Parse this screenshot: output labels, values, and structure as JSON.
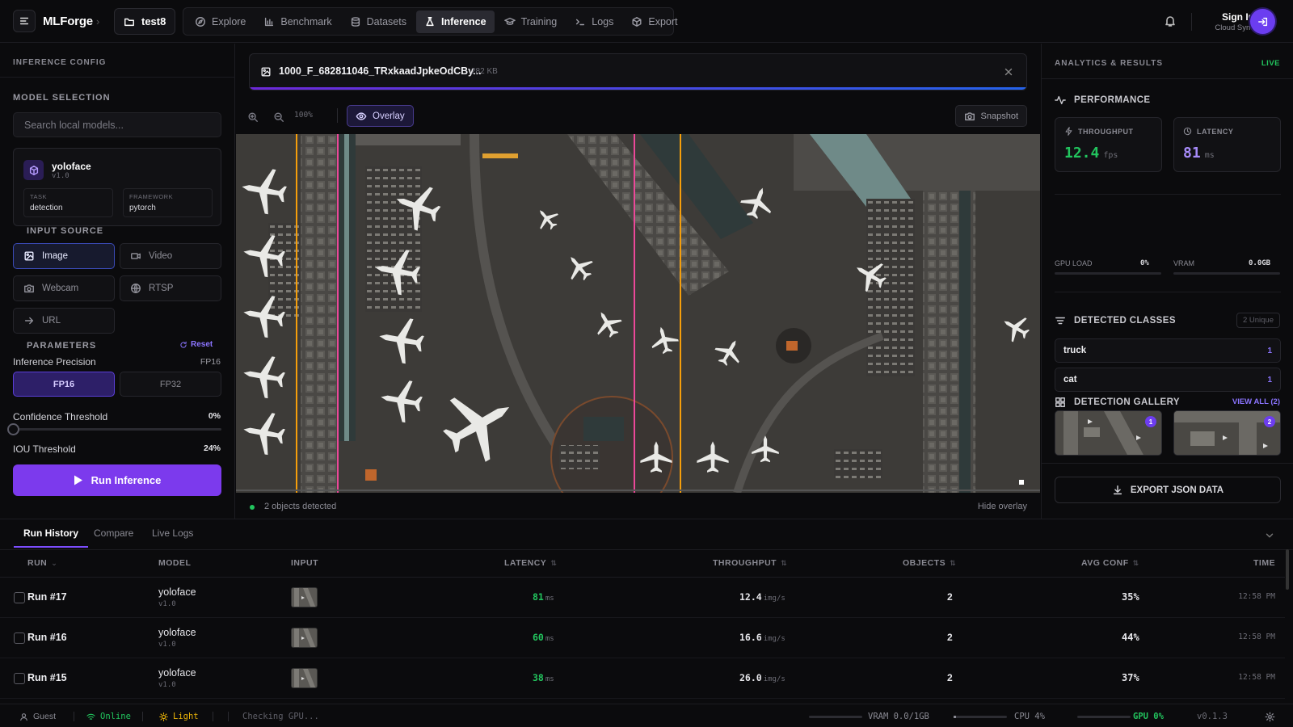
{
  "app": {
    "brand": "MLForge",
    "project": "test8"
  },
  "nav": [
    {
      "label": "Explore",
      "icon": "compass-icon"
    },
    {
      "label": "Benchmark",
      "icon": "bar-chart-icon"
    },
    {
      "label": "Datasets",
      "icon": "database-icon"
    },
    {
      "label": "Inference",
      "icon": "flask-icon",
      "active": true
    },
    {
      "label": "Training",
      "icon": "graduation-icon"
    },
    {
      "label": "Logs",
      "icon": "terminal-icon"
    },
    {
      "label": "Export",
      "icon": "package-icon"
    }
  ],
  "user": {
    "signin": "Sign In",
    "sync": "Cloud Sync"
  },
  "left": {
    "title": "INFERENCE CONFIG",
    "model_selection": "MODEL SELECTION",
    "search_placeholder": "Search local models...",
    "model": {
      "name": "yoloface",
      "version": "v1.0",
      "task_label": "TASK",
      "task": "detection",
      "framework_label": "FRAMEWORK",
      "framework": "pytorch"
    },
    "input_source": "INPUT SOURCE",
    "sources": [
      "Image",
      "Video",
      "Webcam",
      "RTSP",
      "URL"
    ],
    "parameters": "PARAMETERS",
    "reset": "Reset",
    "precision_label": "Inference Precision",
    "precision_value": "FP16",
    "precision_options": [
      "FP16",
      "FP32"
    ],
    "confidence_label": "Confidence Threshold",
    "confidence_value": "0%",
    "confidence_fraction": 0.0,
    "iou_label": "IOU Threshold",
    "iou_value": "24%",
    "run_button": "Run Inference"
  },
  "center": {
    "file_name": "1000_F_682811046_TRxkaadJpkeOdCBy...",
    "file_size": "282 KB",
    "upload_progress": 1.0,
    "zoom": "100%",
    "overlay": "Overlay",
    "snapshot": "Snapshot",
    "objects_detected": "2 objects detected",
    "hide_overlay": "Hide overlay"
  },
  "right": {
    "title": "ANALYTICS & RESULTS",
    "live": "LIVE",
    "performance": "PERFORMANCE",
    "throughput_label": "THROUGHPUT",
    "throughput": "12.4",
    "throughput_unit": "fps",
    "latency_label": "LATENCY",
    "latency": "81",
    "latency_unit": "ms",
    "gpu_load_label": "GPU LOAD",
    "gpu_load": "0%",
    "vram_label": "VRAM",
    "vram": "0.0GB",
    "detected_classes": "DETECTED CLASSES",
    "unique": "2 Unique",
    "classes": [
      {
        "name": "truck",
        "count": "1"
      },
      {
        "name": "cat",
        "count": "1"
      }
    ],
    "gallery": "DETECTION GALLERY",
    "view_all": "VIEW ALL (2)",
    "thumbs": [
      "1",
      "2"
    ],
    "export": "EXPORT JSON DATA",
    "colors": {
      "throughput": "#22c55e",
      "latency": "#a78bfa",
      "accent": "#7c3aed"
    }
  },
  "bottom": {
    "tabs": [
      "Run History",
      "Compare",
      "Live Logs"
    ],
    "headers": {
      "run": "RUN",
      "model": "MODEL",
      "input": "INPUT",
      "latency": "LATENCY",
      "throughput": "THROUGHPUT",
      "objects": "OBJECTS",
      "avg_conf": "AVG CONF",
      "time": "TIME"
    },
    "rows": [
      {
        "run": "Run #17",
        "model": "yoloface",
        "version": "v1.0",
        "latency": "81",
        "latency_unit": "ms",
        "throughput": "12.4",
        "throughput_unit": "img/s",
        "objects": "2",
        "conf": "35%",
        "time": "12:58 PM"
      },
      {
        "run": "Run #16",
        "model": "yoloface",
        "version": "v1.0",
        "latency": "60",
        "latency_unit": "ms",
        "throughput": "16.6",
        "throughput_unit": "img/s",
        "objects": "2",
        "conf": "44%",
        "time": "12:58 PM"
      },
      {
        "run": "Run #15",
        "model": "yoloface",
        "version": "v1.0",
        "latency": "38",
        "latency_unit": "ms",
        "throughput": "26.0",
        "throughput_unit": "img/s",
        "objects": "2",
        "conf": "37%",
        "time": "12:58 PM"
      }
    ]
  },
  "status": {
    "user": "Guest",
    "online": "Online",
    "theme": "Light",
    "gpu_check": "Checking GPU...",
    "vram": "VRAM 0.0/1GB",
    "cpu": "CPU 4%",
    "gpu": "GPU 0%",
    "version": "v0.1.3"
  }
}
